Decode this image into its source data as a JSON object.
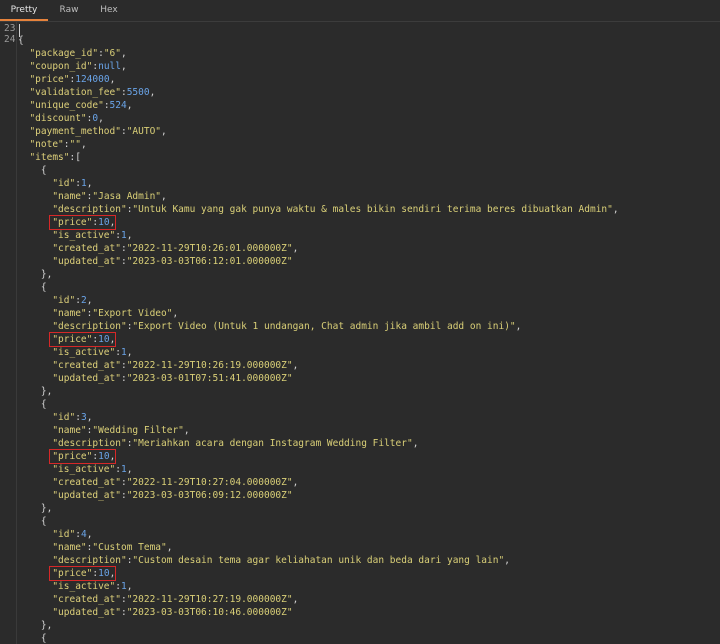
{
  "tabs": [
    {
      "label": "Pretty",
      "active": true
    },
    {
      "label": "Raw",
      "active": false
    },
    {
      "label": "Hex",
      "active": false
    }
  ],
  "line_numbers": [
    "23",
    "24"
  ],
  "colors": {
    "background": "#2b2b2b",
    "key": "#ddd07a",
    "string": "#d9cf77",
    "number": "#6aa4e8",
    "punctuation": "#d4d4d4",
    "highlight_box": "#d62828",
    "active_tab_underline": "#e6833c"
  },
  "code_lines": [
    {
      "indent": "",
      "parts": [
        {
          "t": "p",
          "v": "{"
        }
      ]
    },
    {
      "indent": "  ",
      "parts": [
        {
          "t": "k",
          "v": "\"package_id\""
        },
        {
          "t": "p",
          "v": ":"
        },
        {
          "t": "s",
          "v": "\"6\""
        },
        {
          "t": "p",
          "v": ","
        }
      ]
    },
    {
      "indent": "  ",
      "parts": [
        {
          "t": "k",
          "v": "\"coupon_id\""
        },
        {
          "t": "p",
          "v": ":"
        },
        {
          "t": "n",
          "v": "null"
        },
        {
          "t": "p",
          "v": ","
        }
      ]
    },
    {
      "indent": "  ",
      "parts": [
        {
          "t": "k",
          "v": "\"price\""
        },
        {
          "t": "p",
          "v": ":"
        },
        {
          "t": "n",
          "v": "124000"
        },
        {
          "t": "p",
          "v": ","
        }
      ]
    },
    {
      "indent": "  ",
      "parts": [
        {
          "t": "k",
          "v": "\"validation_fee\""
        },
        {
          "t": "p",
          "v": ":"
        },
        {
          "t": "n",
          "v": "5500"
        },
        {
          "t": "p",
          "v": ","
        }
      ]
    },
    {
      "indent": "  ",
      "parts": [
        {
          "t": "k",
          "v": "\"unique_code\""
        },
        {
          "t": "p",
          "v": ":"
        },
        {
          "t": "n",
          "v": "524"
        },
        {
          "t": "p",
          "v": ","
        }
      ]
    },
    {
      "indent": "  ",
      "parts": [
        {
          "t": "k",
          "v": "\"discount\""
        },
        {
          "t": "p",
          "v": ":"
        },
        {
          "t": "n",
          "v": "0"
        },
        {
          "t": "p",
          "v": ","
        }
      ]
    },
    {
      "indent": "  ",
      "parts": [
        {
          "t": "k",
          "v": "\"payment_method\""
        },
        {
          "t": "p",
          "v": ":"
        },
        {
          "t": "s",
          "v": "\"AUTO\""
        },
        {
          "t": "p",
          "v": ","
        }
      ]
    },
    {
      "indent": "  ",
      "parts": [
        {
          "t": "k",
          "v": "\"note\""
        },
        {
          "t": "p",
          "v": ":"
        },
        {
          "t": "s",
          "v": "\"\""
        },
        {
          "t": "p",
          "v": ","
        }
      ]
    },
    {
      "indent": "  ",
      "parts": [
        {
          "t": "k",
          "v": "\"items\""
        },
        {
          "t": "p",
          "v": ":["
        }
      ]
    },
    {
      "indent": "    ",
      "parts": [
        {
          "t": "p",
          "v": "{"
        }
      ]
    },
    {
      "indent": "      ",
      "parts": [
        {
          "t": "k",
          "v": "\"id\""
        },
        {
          "t": "p",
          "v": ":"
        },
        {
          "t": "n",
          "v": "1"
        },
        {
          "t": "p",
          "v": ","
        }
      ]
    },
    {
      "indent": "      ",
      "parts": [
        {
          "t": "k",
          "v": "\"name\""
        },
        {
          "t": "p",
          "v": ":"
        },
        {
          "t": "s",
          "v": "\"Jasa Admin\""
        },
        {
          "t": "p",
          "v": ","
        }
      ]
    },
    {
      "indent": "      ",
      "parts": [
        {
          "t": "k",
          "v": "\"description\""
        },
        {
          "t": "p",
          "v": ":"
        },
        {
          "t": "s",
          "v": "\"Untuk Kamu yang gak punya waktu & males bikin sendiri terima beres dibuatkan Admin\""
        },
        {
          "t": "p",
          "v": ","
        }
      ]
    },
    {
      "indent": "      ",
      "hl": true,
      "parts": [
        {
          "t": "k",
          "v": "\"price\""
        },
        {
          "t": "p",
          "v": ":"
        },
        {
          "t": "n",
          "v": "10"
        },
        {
          "t": "p",
          "v": ","
        }
      ]
    },
    {
      "indent": "      ",
      "parts": [
        {
          "t": "k",
          "v": "\"is_active\""
        },
        {
          "t": "p",
          "v": ":"
        },
        {
          "t": "n",
          "v": "1"
        },
        {
          "t": "p",
          "v": ","
        }
      ]
    },
    {
      "indent": "      ",
      "parts": [
        {
          "t": "k",
          "v": "\"created_at\""
        },
        {
          "t": "p",
          "v": ":"
        },
        {
          "t": "s",
          "v": "\"2022-11-29T10:26:01.000000Z\""
        },
        {
          "t": "p",
          "v": ","
        }
      ]
    },
    {
      "indent": "      ",
      "parts": [
        {
          "t": "k",
          "v": "\"updated_at\""
        },
        {
          "t": "p",
          "v": ":"
        },
        {
          "t": "s",
          "v": "\"2023-03-03T06:12:01.000000Z\""
        }
      ]
    },
    {
      "indent": "    ",
      "parts": [
        {
          "t": "p",
          "v": "},"
        }
      ]
    },
    {
      "indent": "    ",
      "parts": [
        {
          "t": "p",
          "v": "{"
        }
      ]
    },
    {
      "indent": "      ",
      "parts": [
        {
          "t": "k",
          "v": "\"id\""
        },
        {
          "t": "p",
          "v": ":"
        },
        {
          "t": "n",
          "v": "2"
        },
        {
          "t": "p",
          "v": ","
        }
      ]
    },
    {
      "indent": "      ",
      "parts": [
        {
          "t": "k",
          "v": "\"name\""
        },
        {
          "t": "p",
          "v": ":"
        },
        {
          "t": "s",
          "v": "\"Export Video\""
        },
        {
          "t": "p",
          "v": ","
        }
      ]
    },
    {
      "indent": "      ",
      "parts": [
        {
          "t": "k",
          "v": "\"description\""
        },
        {
          "t": "p",
          "v": ":"
        },
        {
          "t": "s",
          "v": "\"Export Video (Untuk 1 undangan, Chat admin jika ambil add on ini)\""
        },
        {
          "t": "p",
          "v": ","
        }
      ]
    },
    {
      "indent": "      ",
      "hl": true,
      "parts": [
        {
          "t": "k",
          "v": "\"price\""
        },
        {
          "t": "p",
          "v": ":"
        },
        {
          "t": "n",
          "v": "10"
        },
        {
          "t": "p",
          "v": ","
        }
      ]
    },
    {
      "indent": "      ",
      "parts": [
        {
          "t": "k",
          "v": "\"is_active\""
        },
        {
          "t": "p",
          "v": ":"
        },
        {
          "t": "n",
          "v": "1"
        },
        {
          "t": "p",
          "v": ","
        }
      ]
    },
    {
      "indent": "      ",
      "parts": [
        {
          "t": "k",
          "v": "\"created_at\""
        },
        {
          "t": "p",
          "v": ":"
        },
        {
          "t": "s",
          "v": "\"2022-11-29T10:26:19.000000Z\""
        },
        {
          "t": "p",
          "v": ","
        }
      ]
    },
    {
      "indent": "      ",
      "parts": [
        {
          "t": "k",
          "v": "\"updated_at\""
        },
        {
          "t": "p",
          "v": ":"
        },
        {
          "t": "s",
          "v": "\"2023-03-01T07:51:41.000000Z\""
        }
      ]
    },
    {
      "indent": "    ",
      "parts": [
        {
          "t": "p",
          "v": "},"
        }
      ]
    },
    {
      "indent": "    ",
      "parts": [
        {
          "t": "p",
          "v": "{"
        }
      ]
    },
    {
      "indent": "      ",
      "parts": [
        {
          "t": "k",
          "v": "\"id\""
        },
        {
          "t": "p",
          "v": ":"
        },
        {
          "t": "n",
          "v": "3"
        },
        {
          "t": "p",
          "v": ","
        }
      ]
    },
    {
      "indent": "      ",
      "parts": [
        {
          "t": "k",
          "v": "\"name\""
        },
        {
          "t": "p",
          "v": ":"
        },
        {
          "t": "s",
          "v": "\"Wedding Filter\""
        },
        {
          "t": "p",
          "v": ","
        }
      ]
    },
    {
      "indent": "      ",
      "parts": [
        {
          "t": "k",
          "v": "\"description\""
        },
        {
          "t": "p",
          "v": ":"
        },
        {
          "t": "s",
          "v": "\"Meriahkan acara dengan Instagram Wedding Filter\""
        },
        {
          "t": "p",
          "v": ","
        }
      ]
    },
    {
      "indent": "      ",
      "hl": true,
      "parts": [
        {
          "t": "k",
          "v": "\"price\""
        },
        {
          "t": "p",
          "v": ":"
        },
        {
          "t": "n",
          "v": "10"
        },
        {
          "t": "p",
          "v": ","
        }
      ]
    },
    {
      "indent": "      ",
      "parts": [
        {
          "t": "k",
          "v": "\"is_active\""
        },
        {
          "t": "p",
          "v": ":"
        },
        {
          "t": "n",
          "v": "1"
        },
        {
          "t": "p",
          "v": ","
        }
      ]
    },
    {
      "indent": "      ",
      "parts": [
        {
          "t": "k",
          "v": "\"created_at\""
        },
        {
          "t": "p",
          "v": ":"
        },
        {
          "t": "s",
          "v": "\"2022-11-29T10:27:04.000000Z\""
        },
        {
          "t": "p",
          "v": ","
        }
      ]
    },
    {
      "indent": "      ",
      "parts": [
        {
          "t": "k",
          "v": "\"updated_at\""
        },
        {
          "t": "p",
          "v": ":"
        },
        {
          "t": "s",
          "v": "\"2023-03-03T06:09:12.000000Z\""
        }
      ]
    },
    {
      "indent": "    ",
      "parts": [
        {
          "t": "p",
          "v": "},"
        }
      ]
    },
    {
      "indent": "    ",
      "parts": [
        {
          "t": "p",
          "v": "{"
        }
      ]
    },
    {
      "indent": "      ",
      "parts": [
        {
          "t": "k",
          "v": "\"id\""
        },
        {
          "t": "p",
          "v": ":"
        },
        {
          "t": "n",
          "v": "4"
        },
        {
          "t": "p",
          "v": ","
        }
      ]
    },
    {
      "indent": "      ",
      "parts": [
        {
          "t": "k",
          "v": "\"name\""
        },
        {
          "t": "p",
          "v": ":"
        },
        {
          "t": "s",
          "v": "\"Custom Tema\""
        },
        {
          "t": "p",
          "v": ","
        }
      ]
    },
    {
      "indent": "      ",
      "parts": [
        {
          "t": "k",
          "v": "\"description\""
        },
        {
          "t": "p",
          "v": ":"
        },
        {
          "t": "s",
          "v": "\"Custom desain tema agar keliahatan unik dan beda dari yang lain\""
        },
        {
          "t": "p",
          "v": ","
        }
      ]
    },
    {
      "indent": "      ",
      "hl": true,
      "parts": [
        {
          "t": "k",
          "v": "\"price\""
        },
        {
          "t": "p",
          "v": ":"
        },
        {
          "t": "n",
          "v": "10"
        },
        {
          "t": "p",
          "v": ","
        }
      ]
    },
    {
      "indent": "      ",
      "parts": [
        {
          "t": "k",
          "v": "\"is_active\""
        },
        {
          "t": "p",
          "v": ":"
        },
        {
          "t": "n",
          "v": "1"
        },
        {
          "t": "p",
          "v": ","
        }
      ]
    },
    {
      "indent": "      ",
      "parts": [
        {
          "t": "k",
          "v": "\"created_at\""
        },
        {
          "t": "p",
          "v": ":"
        },
        {
          "t": "s",
          "v": "\"2022-11-29T10:27:19.000000Z\""
        },
        {
          "t": "p",
          "v": ","
        }
      ]
    },
    {
      "indent": "      ",
      "parts": [
        {
          "t": "k",
          "v": "\"updated_at\""
        },
        {
          "t": "p",
          "v": ":"
        },
        {
          "t": "s",
          "v": "\"2023-03-03T06:10:46.000000Z\""
        }
      ]
    },
    {
      "indent": "    ",
      "parts": [
        {
          "t": "p",
          "v": "},"
        }
      ]
    },
    {
      "indent": "    ",
      "parts": [
        {
          "t": "p",
          "v": "{"
        }
      ]
    }
  ]
}
